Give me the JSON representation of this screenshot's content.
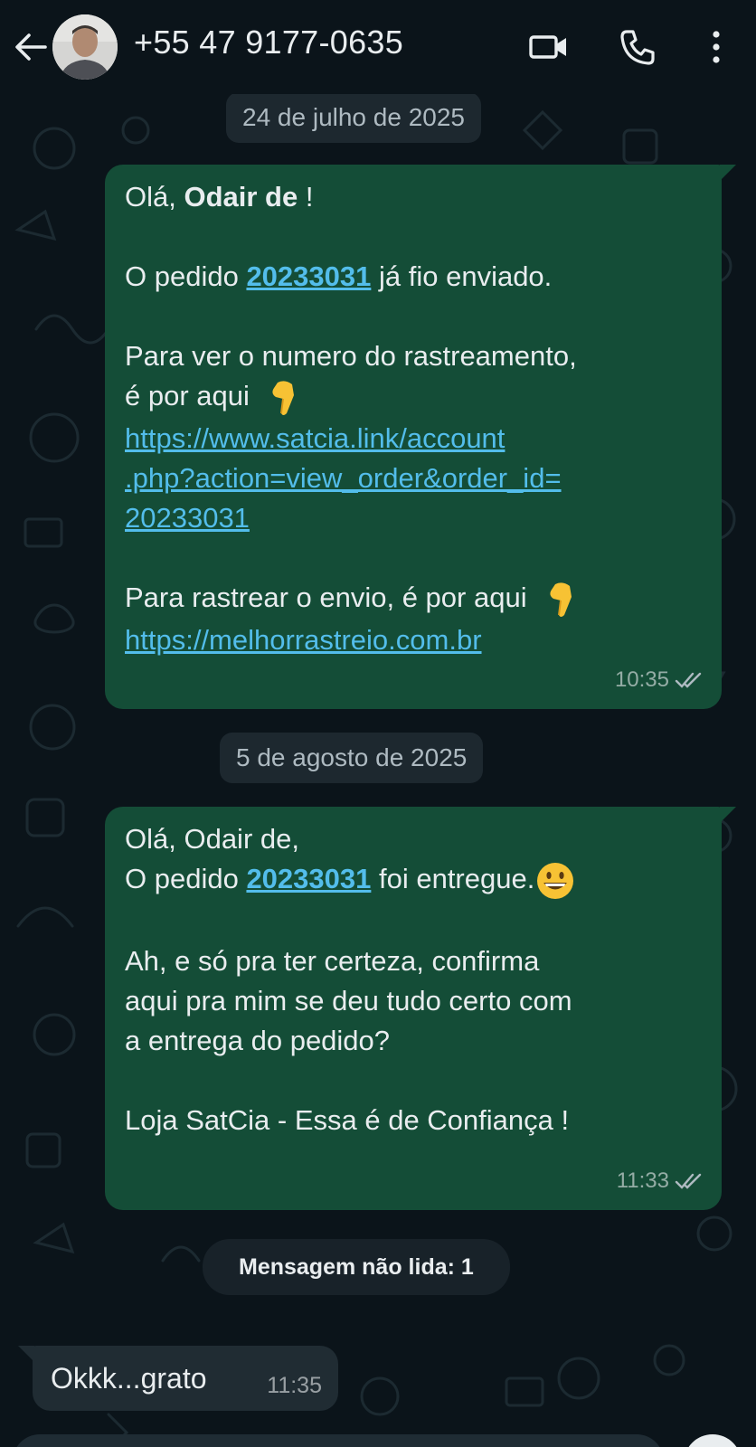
{
  "header": {
    "contact_name": "+55 47 9177-0635",
    "icons": [
      "back-arrow-icon",
      "video-call-icon",
      "phone-call-icon",
      "more-options-icon"
    ]
  },
  "chat": {
    "date_1": "24 de julho de 2025",
    "date_2": "5 de agosto de 2025",
    "unread": "Mensagem não lida: 1",
    "msg1": {
      "greet_pre": "Olá, ",
      "greet_name": "Odair de",
      "greet_post": " !",
      "order_pre": "O pedido ",
      "order_no": "20233031",
      "order_post": " já fio enviado.",
      "track_line1": "Para ver o numero do rastreamento,",
      "track_line2": "é por aqui  ",
      "url1_a": "https://www.satcia.link/account",
      "url1_b": ".php?action=view_order&order_id=",
      "url1_c": "20233031",
      "ship_line": "Para rastrear o envio, é por aqui  ",
      "url2": "https://melhorrastreio.com.br",
      "time": "10:35",
      "emoji": "pointing-down-emoji"
    },
    "msg2": {
      "line1": "Olá, Odair de,",
      "order_pre": "O pedido ",
      "order_no": "20233031",
      "order_post": " foi entregue.",
      "confirm_1": "Ah, e só pra ter certeza, confirma",
      "confirm_2": "aqui pra mim se deu tudo certo com",
      "confirm_3": "a entrega do pedido?",
      "signature": "Loja SatCia - Essa é de Confiança !",
      "time": "11:33",
      "emoji": "grinning-face-emoji"
    },
    "msg3": {
      "text": "Okkk...grato",
      "time": "11:35"
    }
  },
  "colors": {
    "background": "#0b141a",
    "outgoing_bubble": "#144d37",
    "incoming_bubble": "#202c33",
    "link": "#53bdeb",
    "read_ticks": "#aebac1"
  }
}
